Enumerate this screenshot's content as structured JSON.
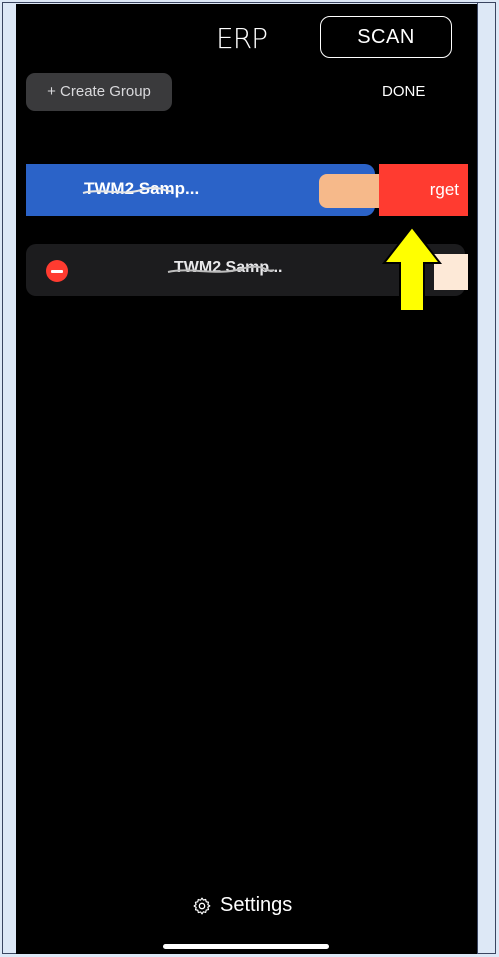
{
  "app": {
    "logo_text": "ERP"
  },
  "header": {
    "scan_label": "SCAN"
  },
  "toolbar": {
    "create_group_label": "+ Create Group",
    "done_label": "DONE"
  },
  "devices": [
    {
      "name": "TWM2 Samp...",
      "swipe_action": "rget"
    },
    {
      "name": "TWM2 Samp..."
    }
  ],
  "footer": {
    "settings_label": "Settings"
  },
  "colors": {
    "background": "#000000",
    "row_selected": "#2b63c8",
    "delete_red": "#ff3b30",
    "arrow_yellow": "#ffff00"
  },
  "icons": {
    "settings": "gear-icon",
    "remove": "minus-circle-icon",
    "annotation": "up-arrow-icon"
  }
}
